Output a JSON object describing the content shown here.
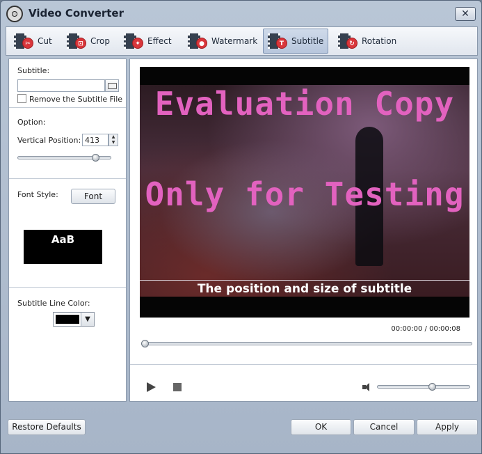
{
  "window": {
    "title": "Video Converter",
    "close_label": "✕"
  },
  "toolbar": {
    "tools": [
      {
        "label": "Cut",
        "icon": "scissors-icon",
        "active": false
      },
      {
        "label": "Crop",
        "icon": "crop-icon",
        "active": false
      },
      {
        "label": "Effect",
        "icon": "effect-icon",
        "active": false
      },
      {
        "label": "Watermark",
        "icon": "watermark-icon",
        "active": false
      },
      {
        "label": "Subtitle",
        "icon": "subtitle-icon",
        "active": true
      },
      {
        "label": "Rotation",
        "icon": "rotation-icon",
        "active": false
      }
    ]
  },
  "left": {
    "subtitle_label": "Subtitle:",
    "subtitle_value": "",
    "remove_label": "Remove the Subtitle File",
    "option_label": "Option:",
    "vertical_label": "Vertical Position:",
    "vertical_value": "413",
    "font_style_label": "Font Style:",
    "font_button": "Font",
    "preview_text": "AaB",
    "line_color_label": "Subtitle Line Color:",
    "line_color": "#000000"
  },
  "player": {
    "watermark_line1": "Evaluation Copy",
    "watermark_line2": "Only for Testing",
    "subtitle_text": "The position and size of subtitle",
    "current_time": "00:00:00",
    "time_sep": "/",
    "total_time": "00:00:08",
    "progress": 0.0,
    "volume": 0.6
  },
  "buttons": {
    "restore": "Restore Defaults",
    "ok": "OK",
    "cancel": "Cancel",
    "apply": "Apply"
  },
  "colors": {
    "watermark_pink": "#e262bf",
    "accent_blue": "#b7c6dc"
  }
}
